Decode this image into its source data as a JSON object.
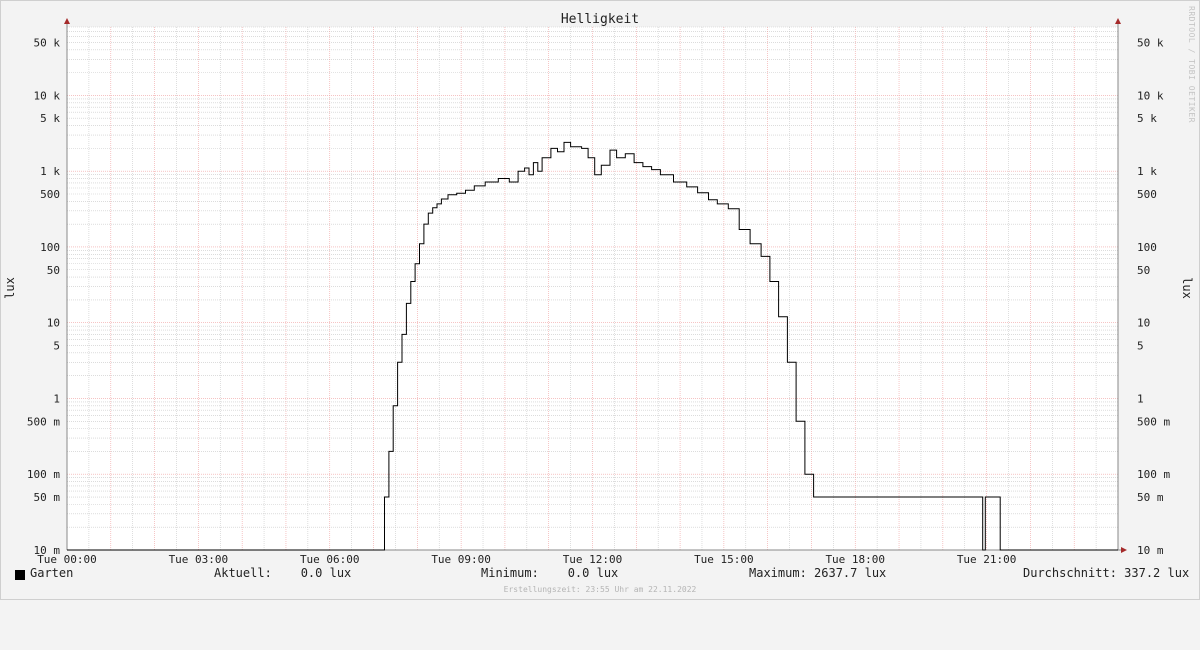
{
  "chart_data": {
    "type": "line",
    "title": "Helligkeit",
    "ylabel": "lux",
    "yscale": "log",
    "ylim": [
      0.01,
      80000
    ],
    "y_tick_labels": [
      {
        "value": 50000,
        "label": "50 k"
      },
      {
        "value": 10000,
        "label": "10 k"
      },
      {
        "value": 5000,
        "label": "5 k"
      },
      {
        "value": 1000,
        "label": "1 k"
      },
      {
        "value": 500,
        "label": "500"
      },
      {
        "value": 100,
        "label": "100"
      },
      {
        "value": 50,
        "label": "50"
      },
      {
        "value": 10,
        "label": "10"
      },
      {
        "value": 5,
        "label": "5"
      },
      {
        "value": 1,
        "label": "1"
      },
      {
        "value": 0.5,
        "label": "500 m"
      },
      {
        "value": 0.1,
        "label": "100 m"
      },
      {
        "value": 0.05,
        "label": "50 m"
      },
      {
        "value": 0.01,
        "label": "10 m"
      }
    ],
    "x_tick_labels": [
      {
        "hour": 0,
        "label": "Tue 00:00"
      },
      {
        "hour": 3,
        "label": "Tue 03:00"
      },
      {
        "hour": 6,
        "label": "Tue 06:00"
      },
      {
        "hour": 9,
        "label": "Tue 09:00"
      },
      {
        "hour": 12,
        "label": "Tue 12:00"
      },
      {
        "hour": 15,
        "label": "Tue 15:00"
      },
      {
        "hour": 18,
        "label": "Tue 18:00"
      },
      {
        "hour": 21,
        "label": "Tue 21:00"
      }
    ],
    "xlim_hours": [
      0,
      24
    ],
    "grid": true,
    "series": [
      {
        "name": "Garten",
        "color": "#000000",
        "x_hours": [
          0.0,
          7.2,
          7.25,
          7.35,
          7.45,
          7.55,
          7.65,
          7.75,
          7.85,
          7.95,
          8.05,
          8.15,
          8.25,
          8.35,
          8.45,
          8.55,
          8.7,
          8.9,
          9.1,
          9.3,
          9.55,
          9.85,
          10.1,
          10.3,
          10.45,
          10.55,
          10.65,
          10.75,
          10.85,
          11.05,
          11.2,
          11.35,
          11.5,
          11.75,
          11.9,
          12.05,
          12.2,
          12.4,
          12.55,
          12.75,
          12.95,
          13.15,
          13.35,
          13.55,
          13.85,
          14.15,
          14.4,
          14.65,
          14.85,
          15.1,
          15.35,
          15.6,
          15.85,
          16.05,
          16.25,
          16.45,
          16.65,
          16.85,
          17.05,
          17.15,
          17.25,
          17.3,
          17.35,
          20.9,
          20.91,
          20.96,
          20.97,
          21.3,
          21.31,
          24.0
        ],
        "y": [
          0.01,
          0.01,
          0.05,
          0.2,
          0.8,
          3,
          7,
          18,
          35,
          60,
          110,
          200,
          280,
          330,
          370,
          430,
          490,
          510,
          560,
          640,
          720,
          800,
          720,
          1000,
          1100,
          900,
          1300,
          1000,
          1500,
          2000,
          1800,
          2400,
          2100,
          2000,
          1500,
          900,
          1200,
          1900,
          1500,
          1700,
          1300,
          1150,
          1050,
          900,
          720,
          620,
          520,
          420,
          370,
          320,
          170,
          110,
          75,
          35,
          12,
          3,
          0.5,
          0.1,
          0.05,
          0.05,
          0.05,
          0.05,
          0.05,
          0.05,
          0.01,
          0.01,
          0.05,
          0.05,
          0.01,
          0.01
        ]
      }
    ]
  },
  "legend": {
    "series_name": "Garten",
    "current": "Aktuell:    0.0 lux",
    "minimum": "Minimum:    0.0 lux",
    "maximum": "Maximum: 2637.7 lux",
    "average": "Durchschnitt: 337.2 lux",
    "swatch_color": "#000000"
  },
  "footer": "Erstellungszeit: 23:55 Uhr am 22.11.2022",
  "watermark": "RRDTOOL / TOBI OETIKER"
}
